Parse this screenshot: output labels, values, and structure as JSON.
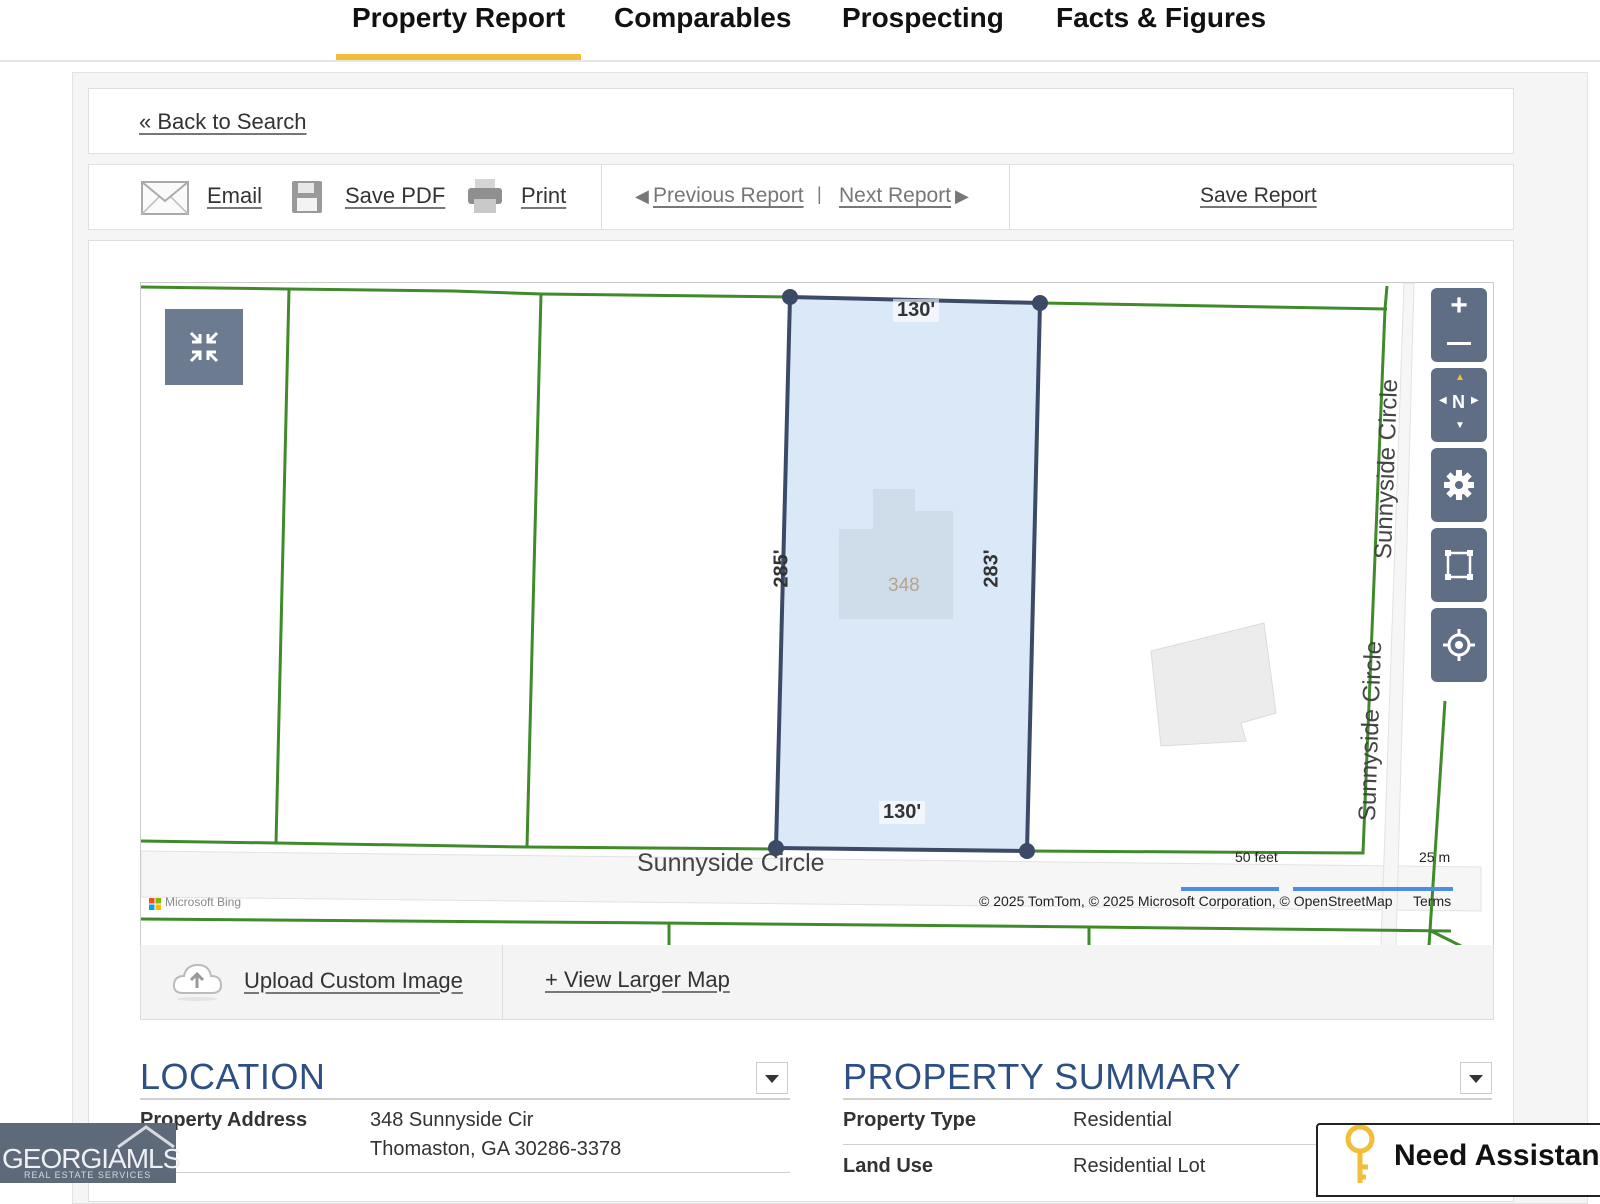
{
  "tabs": [
    {
      "label": "Property Report",
      "active": true
    },
    {
      "label": "Comparables"
    },
    {
      "label": "Prospecting"
    },
    {
      "label": "Facts & Figures"
    }
  ],
  "back_link": "« Back to Search",
  "toolbar": {
    "email": "Email",
    "save_pdf": "Save PDF",
    "print": "Print",
    "previous_report": "Previous Report",
    "separator": "|",
    "next_report": "Next Report",
    "save_report": "Save Report"
  },
  "map": {
    "dimensions": {
      "top": "130'",
      "bottom": "130'",
      "left": "285'",
      "right": "283'"
    },
    "house_number": "348",
    "street_label": "Sunnyside Circle",
    "side_street_labels": [
      "Sunnyside Circle",
      "Sunnyside Circle"
    ],
    "scale_feet": "50 feet",
    "scale_meters": "25 m",
    "provider": "Microsoft Bing",
    "attribution": "© 2025 TomTom, © 2025 Microsoft Corporation, © OpenStreetMap",
    "terms": "Terms",
    "compass": "N"
  },
  "map_footer": {
    "upload": "Upload Custom Image",
    "view_larger": "+ View Larger Map"
  },
  "location": {
    "title": "LOCATION",
    "rows": [
      {
        "label": "Property Address",
        "value_line1": "348 Sunnyside Cir",
        "value_line2": "Thomaston, GA 30286-3378"
      }
    ]
  },
  "property_summary": {
    "title": "PROPERTY SUMMARY",
    "rows": [
      {
        "label": "Property Type",
        "value": "Residential"
      },
      {
        "label": "Land Use",
        "value": "Residential Lot"
      }
    ]
  },
  "brand": {
    "logo_main": "GEORGIAMLS",
    "logo_sub": "REAL ESTATE SERVICES"
  },
  "assist": {
    "label": "Need Assistance"
  },
  "colors": {
    "accent": "#f2bd38",
    "section_title": "#2d4f85",
    "parcel_fill": "#dbe8f8",
    "parcel_line": "#3b4a66",
    "lot_line": "#3f8a2a",
    "map_controls": "#5f6e85"
  }
}
